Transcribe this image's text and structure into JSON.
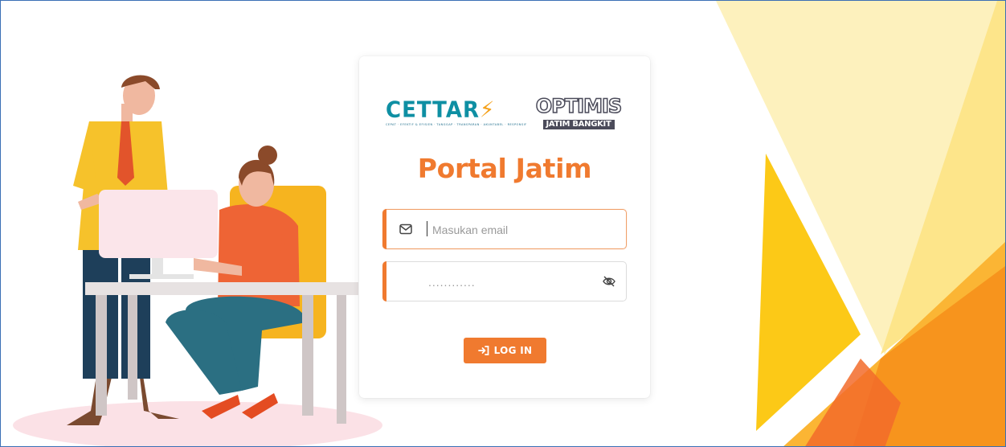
{
  "logos": {
    "left": {
      "word": "CETTAR",
      "tagline": "CEPAT · EFEKTIF & EFISIEN · TANGGAP · TRANSPARAN · AKUNTABEL · RESPONSIF",
      "color": "#0e8fa3"
    },
    "right": {
      "word": "OPTIMIS",
      "sub": "JATIM BANGKIT"
    }
  },
  "title": "Portal Jatim",
  "email": {
    "placeholder": "Masukan email",
    "icon": "envelope-icon"
  },
  "password": {
    "value": "............",
    "icon": "eye-slash-icon"
  },
  "login_button": {
    "label": "LOG IN",
    "icon": "sign-in-icon"
  },
  "colors": {
    "accent": "#f07a2f",
    "frame_border": "#3b6fb5",
    "yellow_light": "#fdf0b8",
    "yellow": "#fcc917",
    "orange": "#f7941d"
  }
}
